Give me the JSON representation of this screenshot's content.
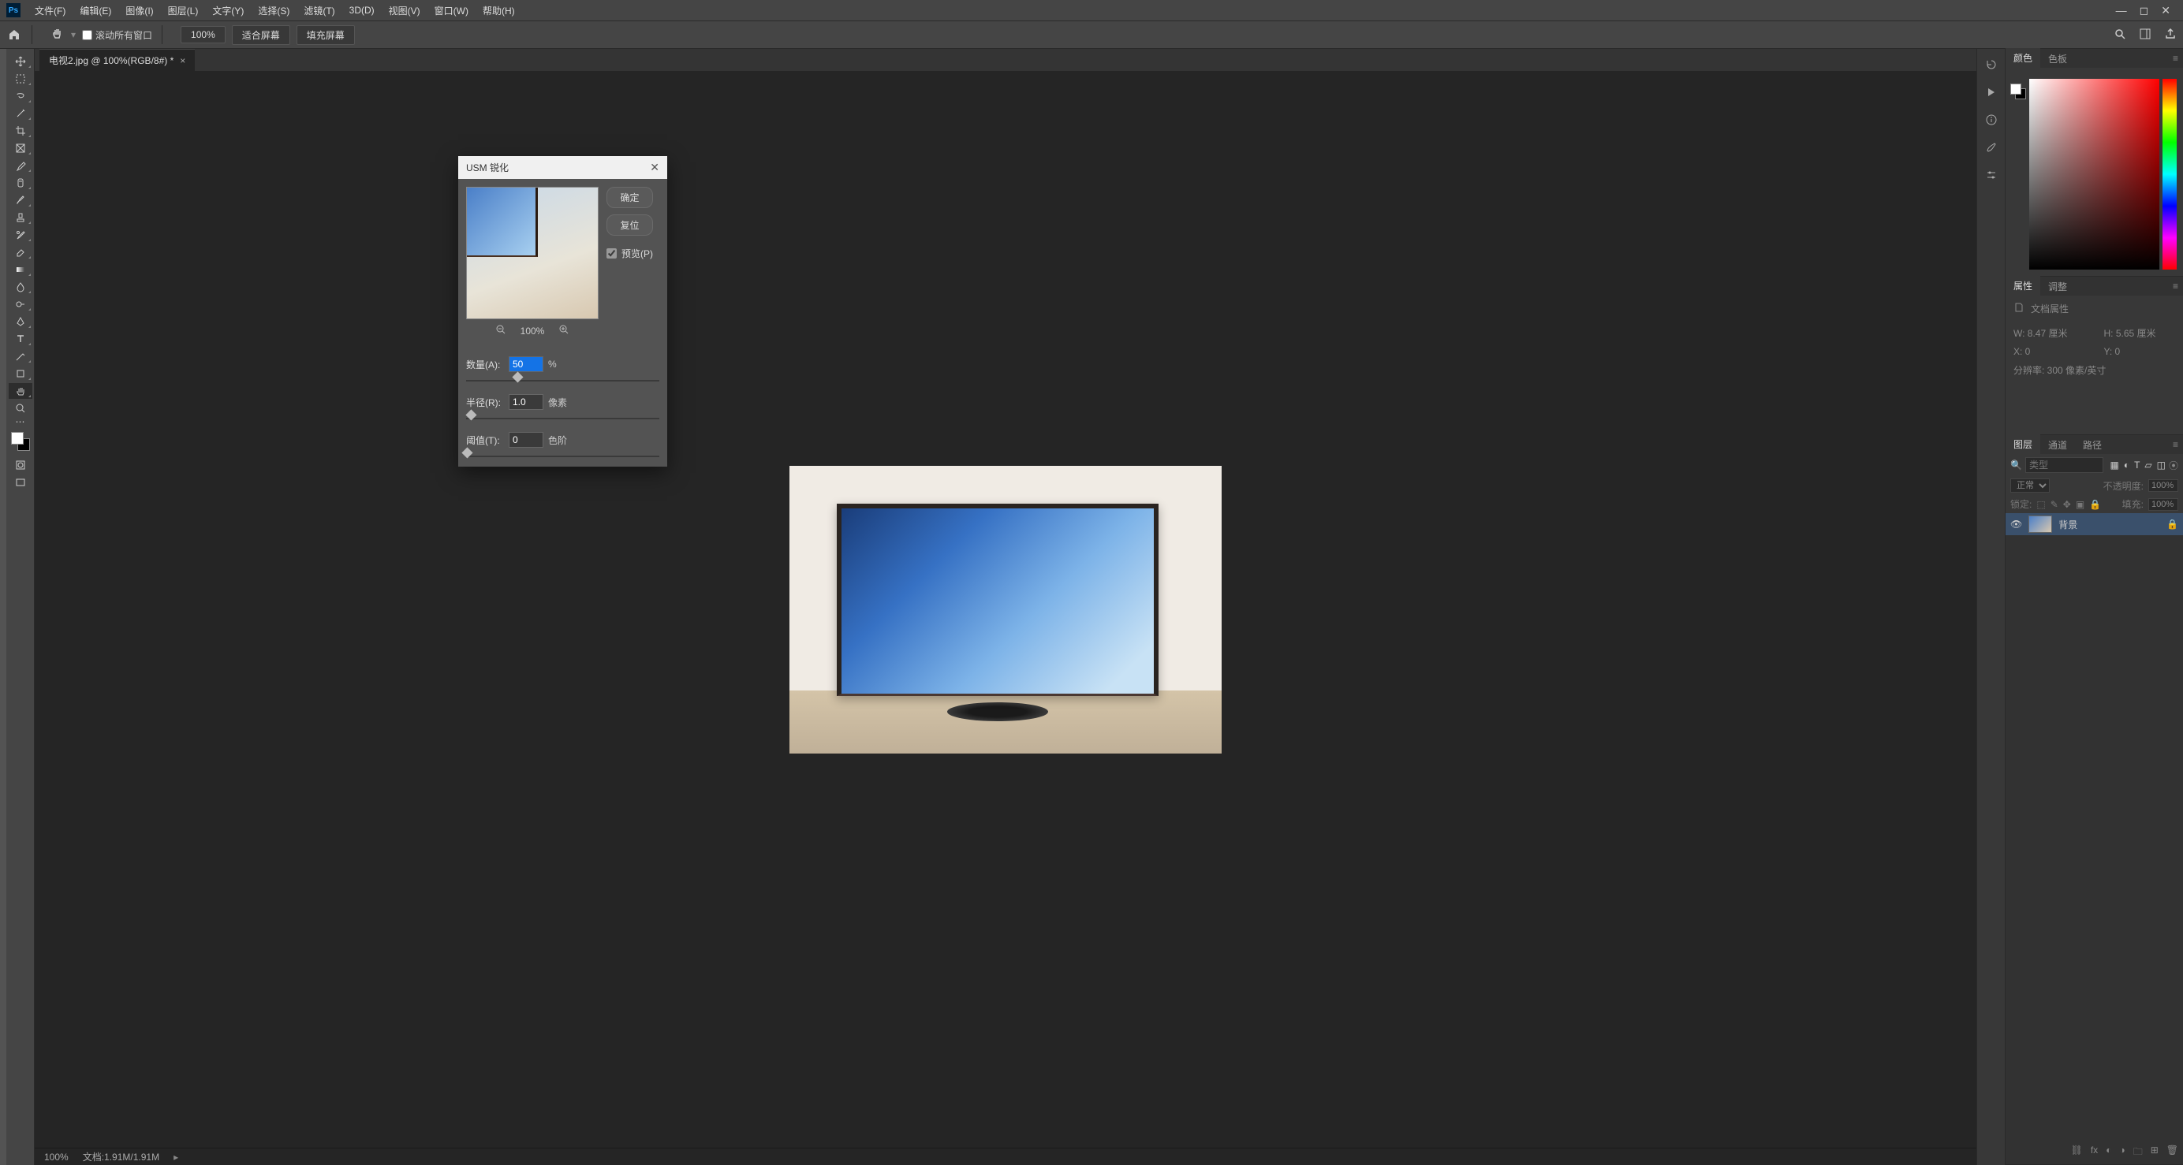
{
  "menubar": {
    "items": [
      "文件(F)",
      "编辑(E)",
      "图像(I)",
      "图层(L)",
      "文字(Y)",
      "选择(S)",
      "滤镜(T)",
      "3D(D)",
      "视图(V)",
      "窗口(W)",
      "帮助(H)"
    ]
  },
  "options": {
    "scroll_all": "滚动所有窗口",
    "zoom": "100%",
    "fit_screen": "适合屏幕",
    "fill_screen": "填充屏幕"
  },
  "document": {
    "tab": "电视2.jpg @ 100%(RGB/8#) *"
  },
  "dialog": {
    "title": "USM 锐化",
    "ok": "确定",
    "reset": "复位",
    "preview": "预览(P)",
    "zoom": "100%",
    "amount_label": "数量(A):",
    "amount_value": "50",
    "amount_unit": "%",
    "radius_label": "半径(R):",
    "radius_value": "1.0",
    "radius_unit": "像素",
    "threshold_label": "阈值(T):",
    "threshold_value": "0",
    "threshold_unit": "色阶"
  },
  "status": {
    "zoom": "100%",
    "doc": "文档:1.91M/1.91M"
  },
  "panels": {
    "color_tabs": [
      "颜色",
      "色板"
    ],
    "props_tabs": [
      "属性",
      "调整"
    ],
    "props_title": "文档属性",
    "props": {
      "w": "W: 8.47 厘米",
      "h": "H: 5.65 厘米",
      "x": "X: 0",
      "y": "Y: 0",
      "res": "分辨率: 300 像素/英寸"
    },
    "layers_tabs": [
      "图层",
      "通道",
      "路径"
    ],
    "layer_search_placeholder": "类型",
    "blend_mode": "正常",
    "opacity_label": "不透明度:",
    "opacity_value": "100%",
    "lock_label": "锁定:",
    "fill_label": "填充:",
    "fill_value": "100%",
    "layer_name": "背景"
  }
}
